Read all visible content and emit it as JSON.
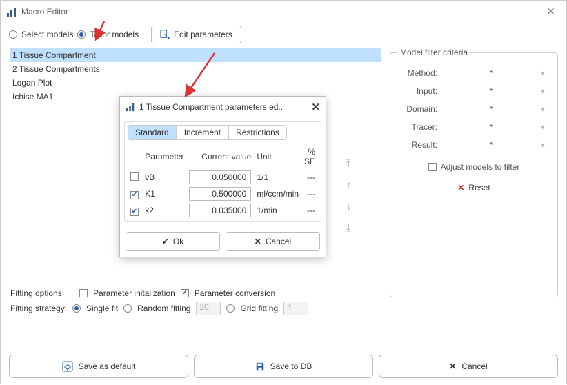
{
  "window": {
    "title": "Macro Editor"
  },
  "mode": {
    "select_label": "Select models",
    "tailor_label": "Tailor models",
    "selected": "tailor"
  },
  "edit_btn": "Edit parameters",
  "models": [
    {
      "name": "1 Tissue Compartment",
      "selected": true
    },
    {
      "name": "2 Tissue Compartments",
      "selected": false
    },
    {
      "name": "Logan Plot",
      "selected": false
    },
    {
      "name": "Ichise MA1",
      "selected": false
    }
  ],
  "filter": {
    "legend": "Model filter criteria",
    "rows": [
      {
        "label": "Method:",
        "value": "*"
      },
      {
        "label": "Input:",
        "value": "*"
      },
      {
        "label": "Domain:",
        "value": "*"
      },
      {
        "label": "Tracer:",
        "value": "*"
      },
      {
        "label": "Result:",
        "value": "*"
      }
    ],
    "adjust": {
      "label": "Adjust models to filter",
      "checked": false
    },
    "reset": "Reset"
  },
  "options": {
    "title": "Fitting options:",
    "param_init": {
      "label": "Parameter initalization",
      "checked": false
    },
    "param_conv": {
      "label": "Parameter conversion",
      "checked": true
    },
    "strategy_title": "Fitting strategy:",
    "single": {
      "label": "Single fit",
      "selected": true
    },
    "random": {
      "label": "Random fitting",
      "selected": false,
      "value": "20"
    },
    "grid": {
      "label": "Grid fitting",
      "selected": false,
      "value": "4"
    }
  },
  "buttons": {
    "save_default": "Save as default",
    "save_db": "Save to DB",
    "cancel": "Cancel"
  },
  "modal": {
    "title": "1 Tissue Compartment parameters ed..",
    "tabs": [
      "Standard",
      "Increment",
      "Restrictions"
    ],
    "active_tab": 0,
    "headers": {
      "p": "Parameter",
      "cv": "Current value",
      "u": "Unit",
      "se": "% SE"
    },
    "rows": [
      {
        "on": false,
        "name": "vB",
        "value": "0.050000",
        "unit": "1/1",
        "se": "---"
      },
      {
        "on": true,
        "name": "K1",
        "value": "0.500000",
        "unit": "ml/ccm/min",
        "se": "---"
      },
      {
        "on": true,
        "name": "k2",
        "value": "0.035000",
        "unit": "1/min",
        "se": "---"
      }
    ],
    "ok": "Ok",
    "cancel": "Cancel"
  }
}
